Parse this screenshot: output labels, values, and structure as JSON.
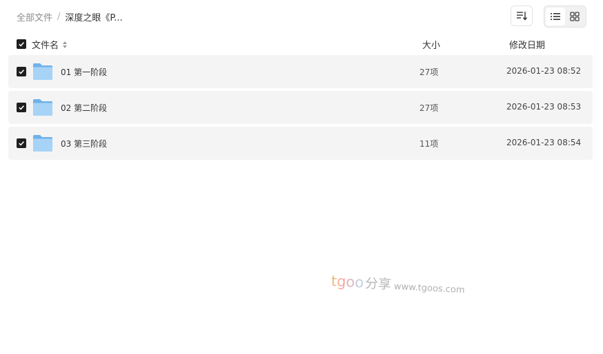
{
  "breadcrumb": {
    "root": "全部文件",
    "separator": "/",
    "current": "深度之眼《P..."
  },
  "toolbar": {
    "sort_icon": "sort-list-icon",
    "view_modes": [
      "list-view-icon",
      "grid-view-icon"
    ],
    "active_view": "list"
  },
  "table": {
    "columns": {
      "name": "文件名",
      "size": "大小",
      "date": "修改日期"
    },
    "rows": [
      {
        "name": "01 第一阶段",
        "size": "27项",
        "date": "2026-01-23 08:52"
      },
      {
        "name": "02 第二阶段",
        "size": "27项",
        "date": "2026-01-23 08:53"
      },
      {
        "name": "03 第三阶段",
        "size": "11项",
        "date": "2026-01-23 08:54"
      }
    ]
  },
  "watermark": {
    "brand": "tgoo",
    "cn": "分享",
    "url": "www.tgoos.com"
  },
  "colors": {
    "row_bg": "#f4f4f4",
    "checkbox": "#1f1f1f",
    "folder": "#7fbff0"
  }
}
